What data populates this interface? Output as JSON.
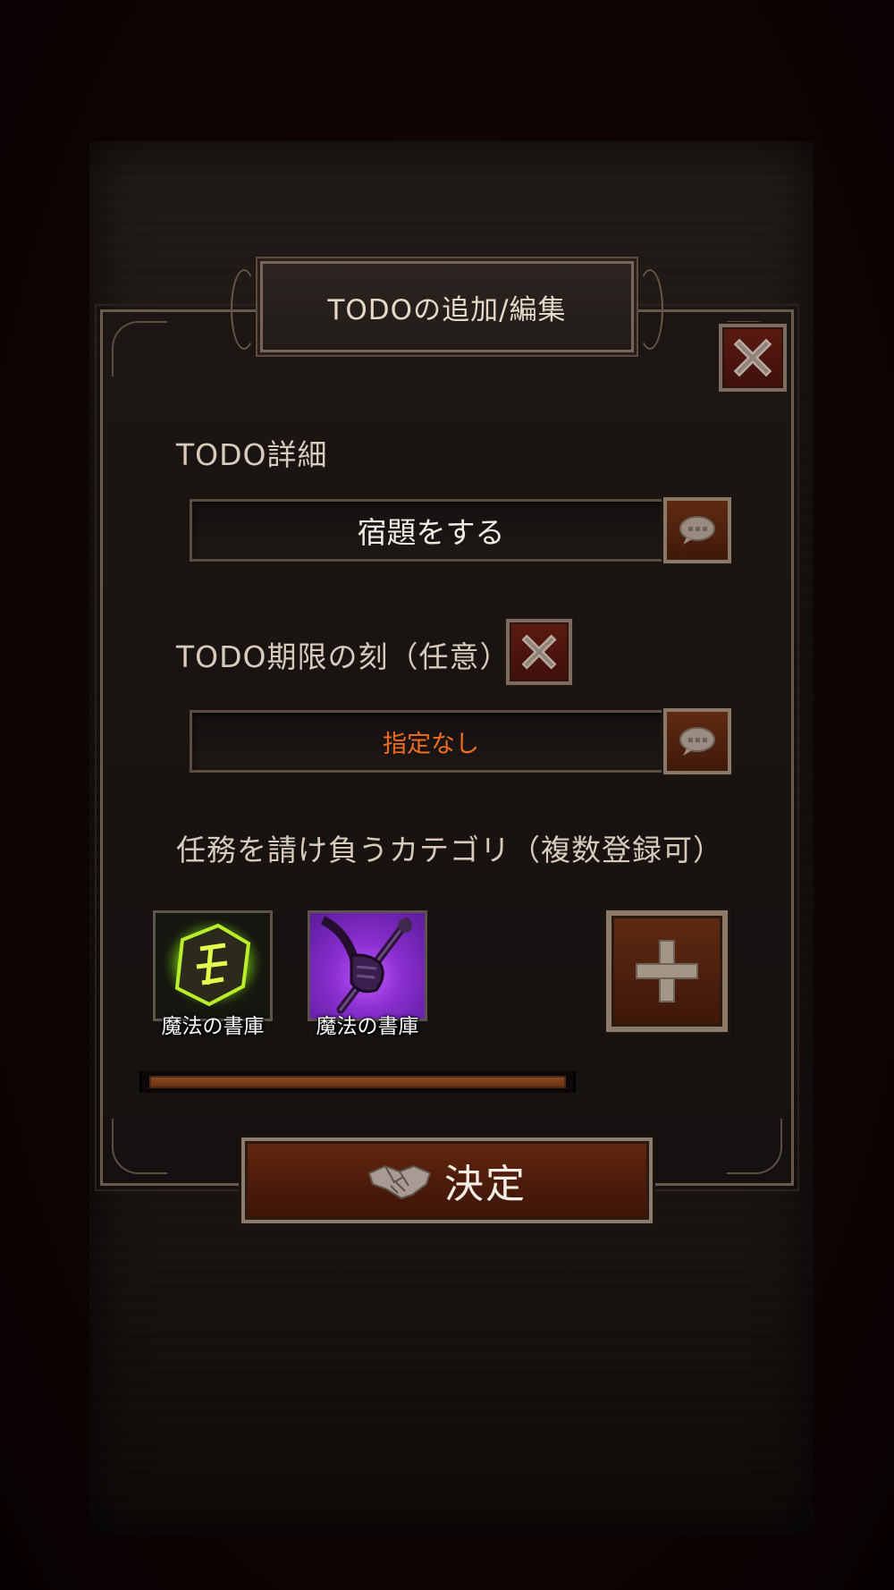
{
  "dialog": {
    "title": "TODOの追加/編集",
    "close_icon": "close-x-icon"
  },
  "detail": {
    "label": "TODO詳細",
    "value": "宿題をする",
    "edit_icon": "speech-bubble-icon"
  },
  "deadline": {
    "label": "TODO期限の刻（任意）",
    "clear_icon": "close-x-icon",
    "value": "指定なし",
    "edit_icon": "speech-bubble-icon"
  },
  "categories": {
    "label": "任務を請け負うカテゴリ（複数登録可）",
    "items": [
      {
        "label": "魔法の書庫",
        "icon": "green-rune-stone-icon"
      },
      {
        "label": "魔法の書庫",
        "icon": "purple-gauntlet-staff-icon"
      }
    ],
    "add_icon": "plus-icon"
  },
  "confirm": {
    "label": "決定",
    "icon": "handshake-icon"
  },
  "colors": {
    "accent_orange": "#ef6d1e",
    "button_brown": "#5a2410",
    "frame": "#7a6658"
  }
}
